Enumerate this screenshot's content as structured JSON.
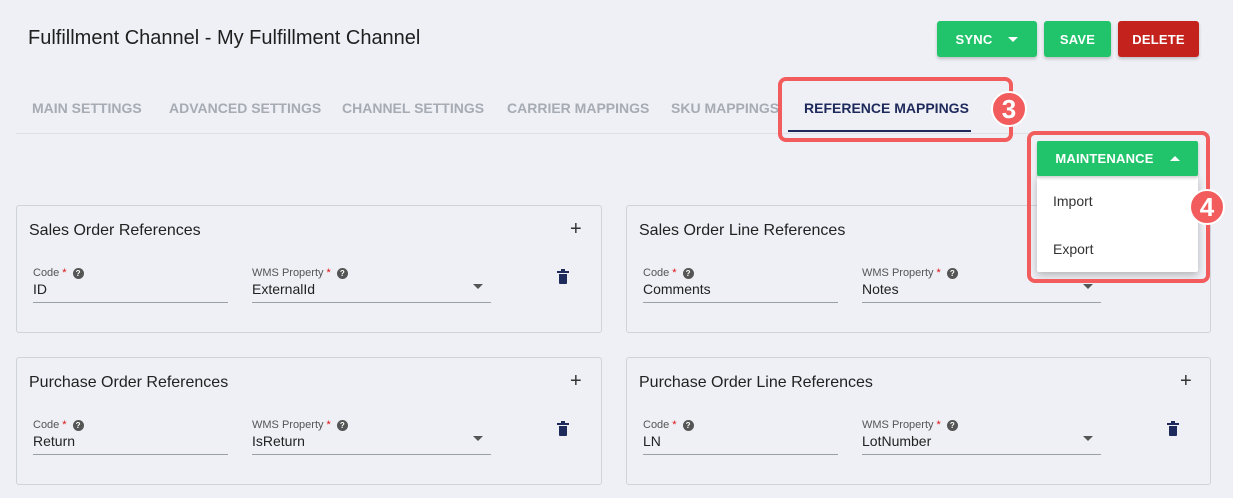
{
  "header": {
    "title": "Fulfillment Channel - My Fulfillment Channel",
    "sync_label": "SYNC",
    "save_label": "SAVE",
    "delete_label": "DELETE"
  },
  "tabs": [
    {
      "label": "MAIN SETTINGS"
    },
    {
      "label": "ADVANCED SETTINGS"
    },
    {
      "label": "CHANNEL SETTINGS"
    },
    {
      "label": "CARRIER MAPPINGS"
    },
    {
      "label": "SKU MAPPINGS"
    },
    {
      "label": "REFERENCE MAPPINGS",
      "active": true
    }
  ],
  "annotations": {
    "step3": "3",
    "step4": "4"
  },
  "maintenance": {
    "label": "MAINTENANCE",
    "items": [
      "Import",
      "Export"
    ]
  },
  "field_labels": {
    "code": "Code",
    "wms_property": "WMS Property",
    "required": "*",
    "help": "?"
  },
  "plus_glyph": "+",
  "cards": [
    {
      "title": "Sales Order References",
      "code": "ID",
      "wms_property": "ExternalId"
    },
    {
      "title": "Sales Order Line References",
      "code": "Comments",
      "wms_property": "Notes"
    },
    {
      "title": "Purchase Order References",
      "code": "Return",
      "wms_property": "IsReturn"
    },
    {
      "title": "Purchase Order Line References",
      "code": "LN",
      "wms_property": "LotNumber"
    }
  ],
  "colors": {
    "accent_green": "#21c46b",
    "danger_red": "#c4231d",
    "highlight": "#f25c5c",
    "navy": "#1f2a5c"
  }
}
